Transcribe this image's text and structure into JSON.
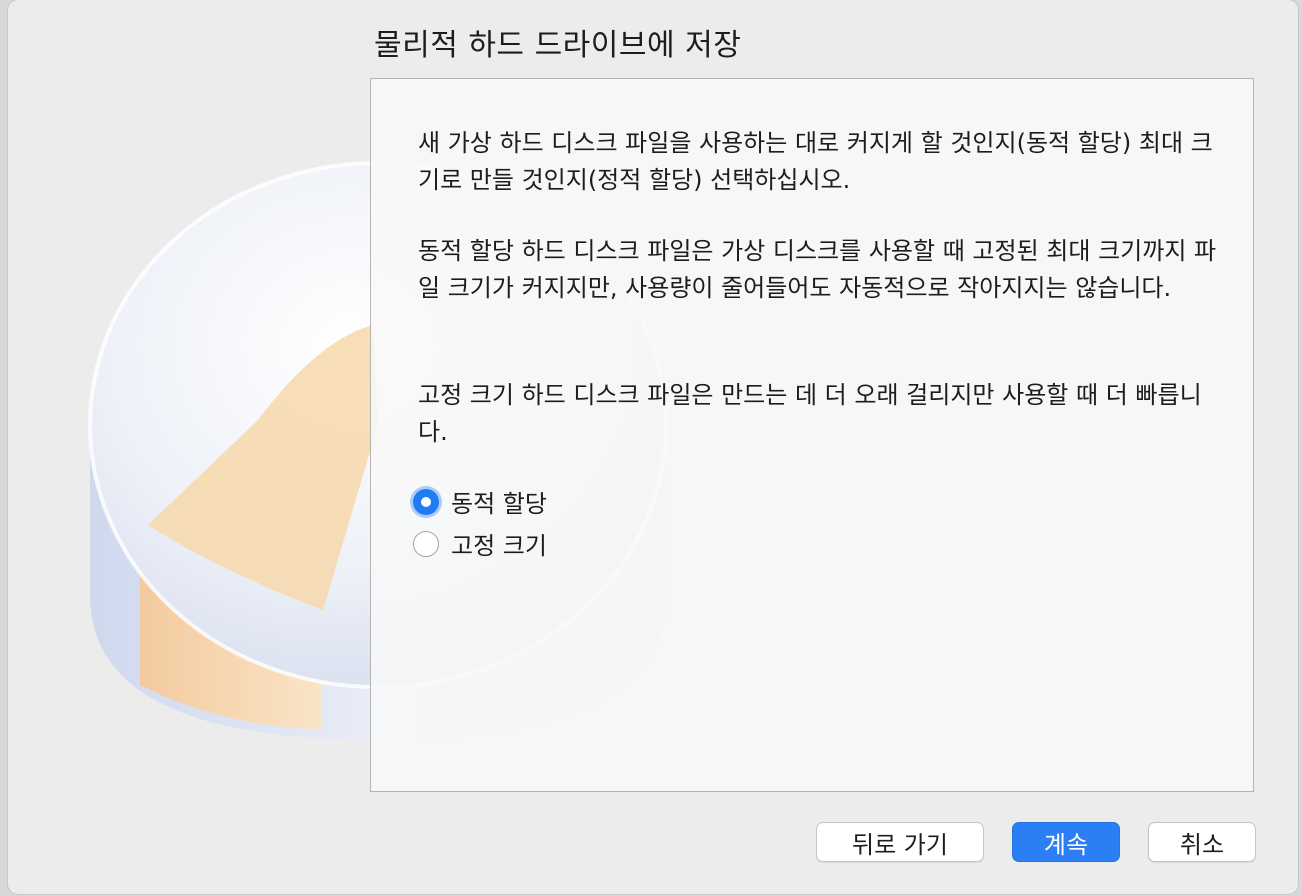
{
  "title": "물리적 하드 드라이브에 저장",
  "paragraphs": [
    "새 가상 하드 디스크 파일을 사용하는 대로 커지게 할 것인지(동적 할당) 최대 크기로 만들 것인지(정적 할당) 선택하십시오.",
    "동적 할당 하드 디스크 파일은 가상 디스크를 사용할 때 고정된 최대 크기까지 파일 크기가 커지지만, 사용량이 줄어들어도 자동적으로 작아지지는 않습니다.",
    "고정 크기 하드 디스크 파일은 만드는 데 더 오래 걸리지만 사용할 때 더 빠릅니다."
  ],
  "options": [
    {
      "label": "동적 할당",
      "selected": true
    },
    {
      "label": "고정 크기",
      "selected": false
    }
  ],
  "buttons": {
    "back": "뒤로 가기",
    "continue": "계속",
    "cancel": "취소"
  },
  "colors": {
    "accent": "#2b7ef4",
    "disk_slice": "#f7d9ad",
    "disk_body": "#dfe6f4"
  }
}
